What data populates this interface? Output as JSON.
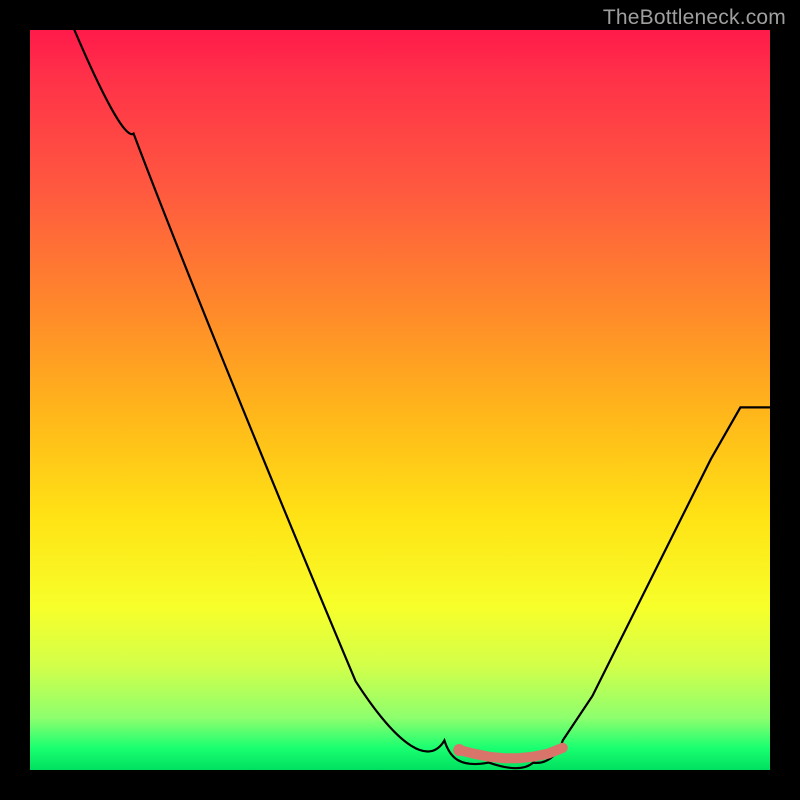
{
  "watermark": "TheBottleneck.com",
  "chart_data": {
    "type": "line",
    "title": "",
    "xlabel": "",
    "ylabel": "",
    "xlim": [
      0,
      100
    ],
    "ylim": [
      0,
      100
    ],
    "grid": false,
    "series": [
      {
        "name": "bottleneck-curve",
        "x": [
          6,
          10,
          14,
          18,
          22,
          26,
          30,
          34,
          38,
          42,
          46,
          50,
          54,
          56,
          58,
          62,
          65,
          68,
          72,
          76,
          80,
          84,
          88,
          92,
          96,
          100
        ],
        "values": [
          100,
          94,
          86,
          78,
          70,
          62,
          55,
          47,
          40,
          32,
          25,
          18,
          11,
          7,
          4,
          1,
          0,
          0,
          1,
          4,
          10,
          18,
          26,
          34,
          42,
          49
        ]
      },
      {
        "name": "optimal-range-marker",
        "x": [
          58,
          60,
          62,
          64,
          66,
          68,
          70,
          72
        ],
        "values": [
          2.7,
          2.2,
          1.8,
          1.6,
          1.6,
          1.8,
          2.2,
          3.0
        ]
      }
    ],
    "background_gradient": {
      "direction": "vertical",
      "stops": [
        {
          "pos": 0.0,
          "color": "#ff1a4a"
        },
        {
          "pos": 0.38,
          "color": "#ff8a2a"
        },
        {
          "pos": 0.66,
          "color": "#ffe315"
        },
        {
          "pos": 0.93,
          "color": "#8dff6e"
        },
        {
          "pos": 1.0,
          "color": "#00e060"
        }
      ]
    }
  }
}
